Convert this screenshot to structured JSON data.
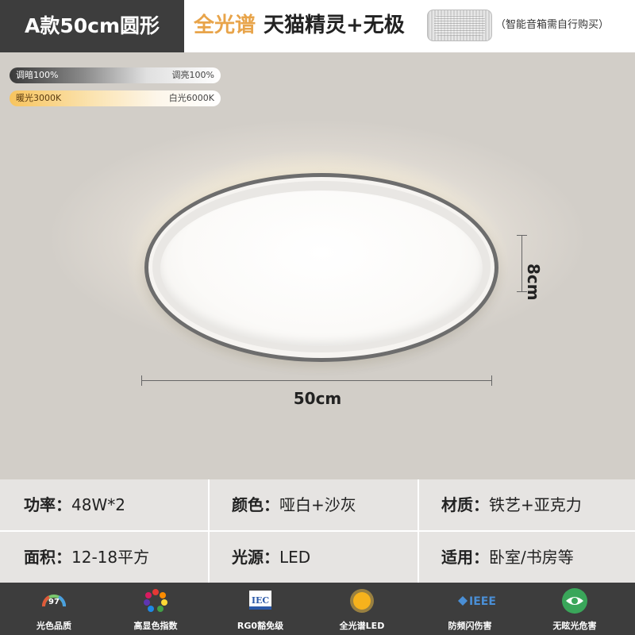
{
  "header": {
    "model_tag": "A款50cm圆形",
    "feature_accent": "全光谱",
    "feature_main": "天猫精灵+无极",
    "feature_note": "（智能音箱需自行购买）"
  },
  "sliders": {
    "dimming": {
      "left": "调暗100%",
      "right": "调亮100%"
    },
    "color_temp": {
      "left": "暖光3000K",
      "right": "白光6000K"
    }
  },
  "dimensions": {
    "width": "50cm",
    "height": "8cm"
  },
  "specs": [
    {
      "label": "功率：",
      "value": "48W*2"
    },
    {
      "label": "颜色：",
      "value": "哑白+沙灰"
    },
    {
      "label": "材质：",
      "value": "铁艺+亚克力"
    },
    {
      "label": "面积：",
      "value": "12-18平方"
    },
    {
      "label": "光源：",
      "value": "LED"
    },
    {
      "label": "适用：",
      "value": "卧室/书房等"
    }
  ],
  "features": [
    {
      "icon": "cri-97-icon",
      "badge": "97",
      "label": "光色品质"
    },
    {
      "icon": "color-wheel-icon",
      "label": "高显色指数"
    },
    {
      "icon": "iec-logo-icon",
      "badge": "IEC",
      "label": "RG0豁免级"
    },
    {
      "icon": "sun-icon",
      "label": "全光谱LED"
    },
    {
      "icon": "ieee-logo-icon",
      "badge": "IEEE",
      "label": "防频闪伤害"
    },
    {
      "icon": "eye-icon",
      "label": "无眩光危害"
    }
  ],
  "colors": {
    "accent": "#e8a44a",
    "dark_bar": "#3d3d3d",
    "spec_bg": "#e6e4e2"
  }
}
